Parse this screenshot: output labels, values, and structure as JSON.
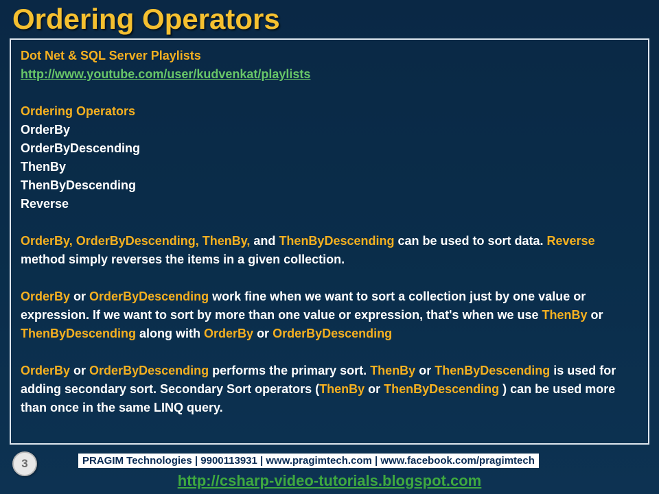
{
  "title": "Ordering Operators",
  "header": {
    "playlists_label": "Dot Net & SQL Server Playlists",
    "playlists_url": "http://www.youtube.com/user/kudvenkat/playlists"
  },
  "section_heading": "Ordering Operators",
  "operators": [
    "OrderBy",
    "OrderByDescending",
    "ThenBy",
    "ThenByDescending",
    "Reverse"
  ],
  "para1": {
    "g1": "OrderBy, OrderByDescending, ThenBy,",
    "t1": " and ",
    "g2": "ThenByDescending",
    "t2": " can be used to sort data. ",
    "g3": "Reverse",
    "t3": " method simply reverses the items in a given collection."
  },
  "para2": {
    "g1": "OrderBy",
    "t1": " or ",
    "g2": "OrderByDescending",
    "t2": " work fine when we want to sort a collection just by one value or expression. If we want to sort by more than one value or expression, that's when we use ",
    "g3": "ThenBy",
    "t3": " or ",
    "g4": "ThenByDescending",
    "t4": " along with ",
    "g5": "OrderBy",
    "t5": " or ",
    "g6": "OrderByDescending"
  },
  "para3": {
    "g1": "OrderBy",
    "t1": " or ",
    "g2": "OrderByDescending",
    "t2": " performs the primary sort. ",
    "g3": "ThenBy",
    "t3": " or ",
    "g4": "ThenByDescending",
    "t4": " is used for adding secondary sort. Secondary Sort operators (",
    "g5": "ThenBy",
    "t5": " or ",
    "g6": "ThenByDescending",
    "t6": " ) can be used more than once in the same LINQ query."
  },
  "footer": {
    "page_number": "3",
    "bar_text": "PRAGIM Technologies | 9900113931 | www.pragimtech.com | www.facebook.com/pragimtech",
    "blog_url": "http://csharp-video-tutorials.blogspot.com"
  }
}
